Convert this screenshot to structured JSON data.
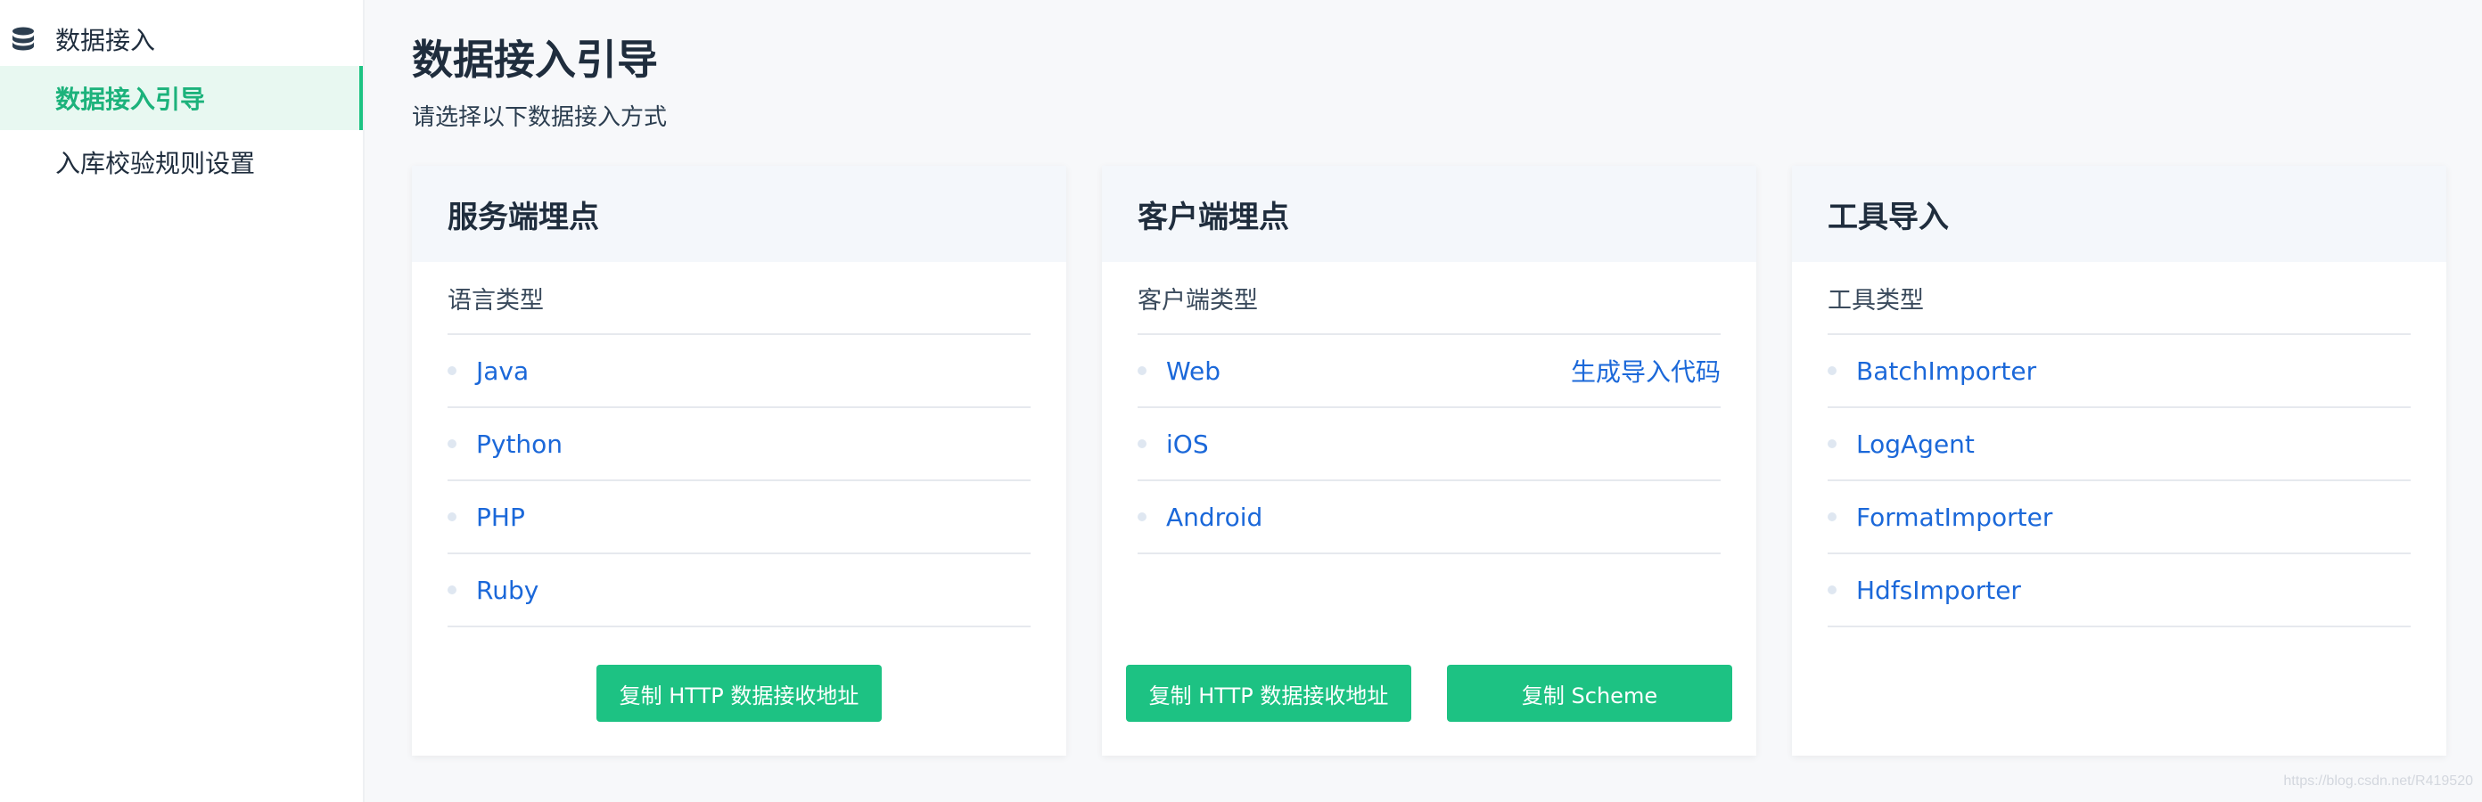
{
  "sidebar": {
    "group": {
      "label": "数据接入",
      "icon": "database-icon"
    },
    "items": [
      {
        "label": "数据接入引导",
        "active": true
      },
      {
        "label": "入库校验规则设置",
        "active": false
      }
    ]
  },
  "main": {
    "title": "数据接入引导",
    "subtitle": "请选择以下数据接入方式",
    "cards": [
      {
        "title": "服务端埋点",
        "list_head": "语言类型",
        "items": [
          "Java",
          "Python",
          "PHP",
          "Ruby"
        ],
        "buttons": [
          "复制 HTTP 数据接收地址"
        ]
      },
      {
        "title": "客户端埋点",
        "list_head": "客户端类型",
        "items": [
          "Web",
          "iOS",
          "Android"
        ],
        "row_action": "生成导入代码",
        "buttons": [
          "复制 HTTP 数据接收地址",
          "复制 Scheme"
        ]
      },
      {
        "title": "工具导入",
        "list_head": "工具类型",
        "items": [
          "BatchImporter",
          "LogAgent",
          "FormatImporter",
          "HdfsImporter"
        ],
        "buttons": []
      }
    ]
  },
  "watermark": "https://blog.csdn.net/R419520",
  "colors": {
    "accent": "#1dc283",
    "link": "#1b68d9",
    "active_bg": "#e8f8f1"
  }
}
